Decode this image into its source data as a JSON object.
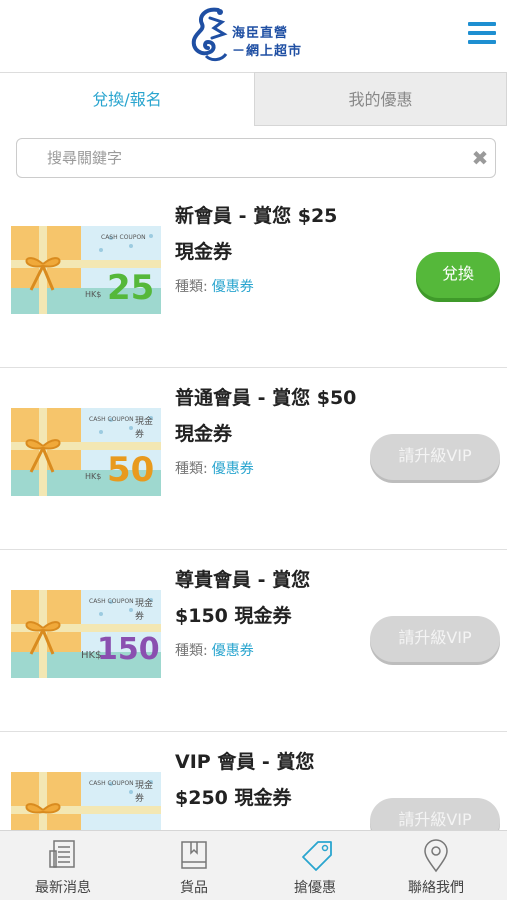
{
  "header": {
    "logo_line1": "海臣直營",
    "logo_line2": "－網上超市",
    "menu_icon": "hamburger-menu-icon"
  },
  "tabs": [
    {
      "label": "兌換/報名",
      "active": true
    },
    {
      "label": "我的優惠",
      "active": false
    }
  ],
  "search": {
    "placeholder": "搜尋關鍵字",
    "value": "",
    "clear_icon": "close-icon"
  },
  "items": [
    {
      "title_line1": "新會員 - 賞您 $25",
      "title_line2": "現金券",
      "type_label": "種類:",
      "type_value": "優惠券",
      "coupon_amount": "25",
      "coupon_currency": "HK$",
      "coupon_header": "CASH COUPON",
      "coupon_header_zh": "現金券",
      "button_label": "兌換",
      "button_style": "green"
    },
    {
      "title_line1": "普通會員 - 賞您 $50",
      "title_line2": "現金券",
      "type_label": "種類:",
      "type_value": "優惠券",
      "coupon_amount": "50",
      "coupon_currency": "HK$",
      "coupon_header": "CASH COUPON",
      "coupon_header_zh": "現金券",
      "button_label": "請升級VIP",
      "button_style": "gray"
    },
    {
      "title_line1": "尊貴會員 - 賞您",
      "title_line2": "$150 現金券",
      "type_label": "種類:",
      "type_value": "優惠券",
      "coupon_amount": "150",
      "coupon_currency": "HK$",
      "coupon_header": "CASH COUPON",
      "coupon_header_zh": "現金券",
      "button_label": "請升級VIP",
      "button_style": "gray"
    },
    {
      "title_line1": "VIP 會員 - 賞您",
      "title_line2": "$250 現金券",
      "coupon_header": "CASH COUPON",
      "coupon_header_zh": "現金券",
      "button_label": "請升級VIP",
      "button_style": "gray"
    }
  ],
  "bottom_nav": [
    {
      "label": "最新消息",
      "icon": "newspaper-icon"
    },
    {
      "label": "貨品",
      "icon": "book-icon"
    },
    {
      "label": "搶優惠",
      "icon": "tag-icon",
      "active": true
    },
    {
      "label": "聯絡我們",
      "icon": "location-pin-icon"
    }
  ],
  "colors": {
    "accent": "#2aa5cf",
    "brand_blue": "#1f4fa3",
    "green_button": "#55b83a",
    "gray_button": "#d5d5d5",
    "coupon_amount_25": "#55b83a",
    "coupon_amount_50": "#e89a1e",
    "coupon_amount_150": "#8a4fb0"
  }
}
